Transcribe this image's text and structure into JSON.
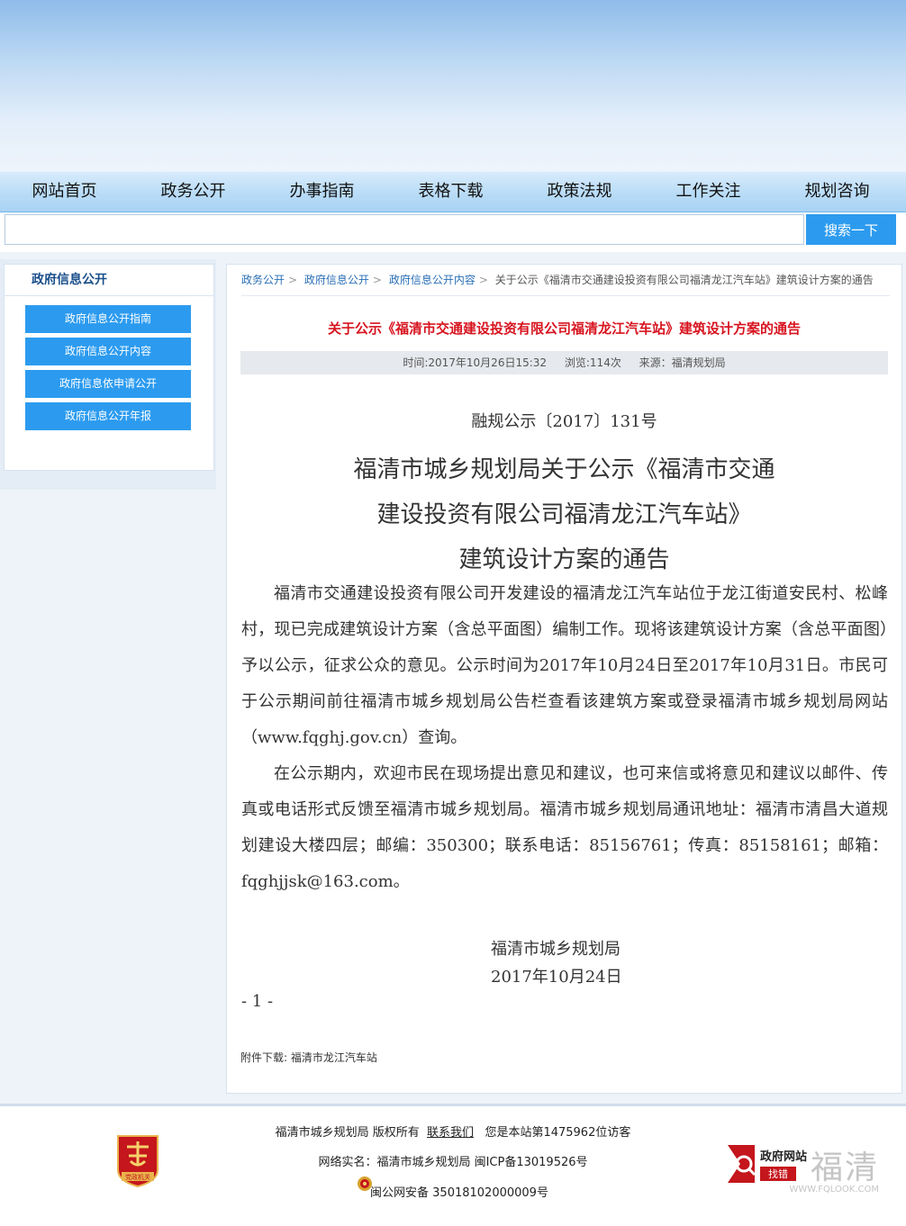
{
  "nav": {
    "items": [
      "网站首页",
      "政务公开",
      "办事指南",
      "表格下载",
      "政策法规",
      "工作关注",
      "规划咨询"
    ]
  },
  "search": {
    "value": "",
    "button": "搜索一下"
  },
  "sidebar": {
    "title": "政府信息公开",
    "items": [
      "政府信息公开指南",
      "政府信息公开内容",
      "政府信息依申请公开",
      "政府信息公开年报"
    ]
  },
  "breadcrumb": {
    "items": [
      "政务公开",
      "政府信息公开",
      "政府信息公开内容"
    ],
    "current": "关于公示《福清市交通建设投资有限公司福清龙江汽车站》建筑设计方案的通告"
  },
  "article": {
    "title": "关于公示《福清市交通建设投资有限公司福清龙江汽车站》建筑设计方案的通告",
    "meta": {
      "time": "时间:2017年10月26日15:32",
      "views": "浏览:114次",
      "source": "来源：福清规划局"
    },
    "doc_number": "融规公示〔2017〕131号",
    "heading_lines": [
      "福清市城乡规划局关于公示《福清市交通",
      "建设投资有限公司福清龙江汽车站》",
      "建筑设计方案的通告"
    ],
    "paragraphs": [
      "福清市交通建设投资有限公司开发建设的福清龙江汽车站位于龙江街道安民村、松峰村，现已完成建筑设计方案（含总平面图）编制工作。现将该建筑设计方案（含总平面图）予以公示，征求公众的意见。公示时间为2017年10月24日至2017年10月31日。市民可于公示期间前往福清市城乡规划局公告栏查看该建筑方案或登录福清市城乡规划局网站（www.fqghj.gov.cn）查询。",
      "在公示期内，欢迎市民在现场提出意见和建议，也可来信或将意见和建议以邮件、传真或电话形式反馈至福清市城乡规划局。福清市城乡规划局通讯地址：福清市清昌大道规划建设大楼四层；邮编：350300；联系电话：85156761；传真：85158161；邮箱：fqghjjsk@163.com。"
    ],
    "signature_org": "福清市城乡规划局",
    "signature_date": "2017年10月24日",
    "page_number": "- 1 -",
    "attachment_label": "附件下载:",
    "attachment_name": "福清市龙江汽车站"
  },
  "footer": {
    "copyright": "福清市城乡规划局 版权所有",
    "contact_link": "联系我们",
    "visitor": "您是本站第1475962位访客",
    "registration": "网络实名：福清市城乡规划局 闽ICP备13019526号",
    "police": "闽公网安备 35018102000009号",
    "emblem_text": "党政机关",
    "gov_badge_line1": "政府网站",
    "gov_badge_line2": "找错",
    "watermark_main": "福清",
    "watermark_url": "WWW.FQLOOK.COM"
  }
}
